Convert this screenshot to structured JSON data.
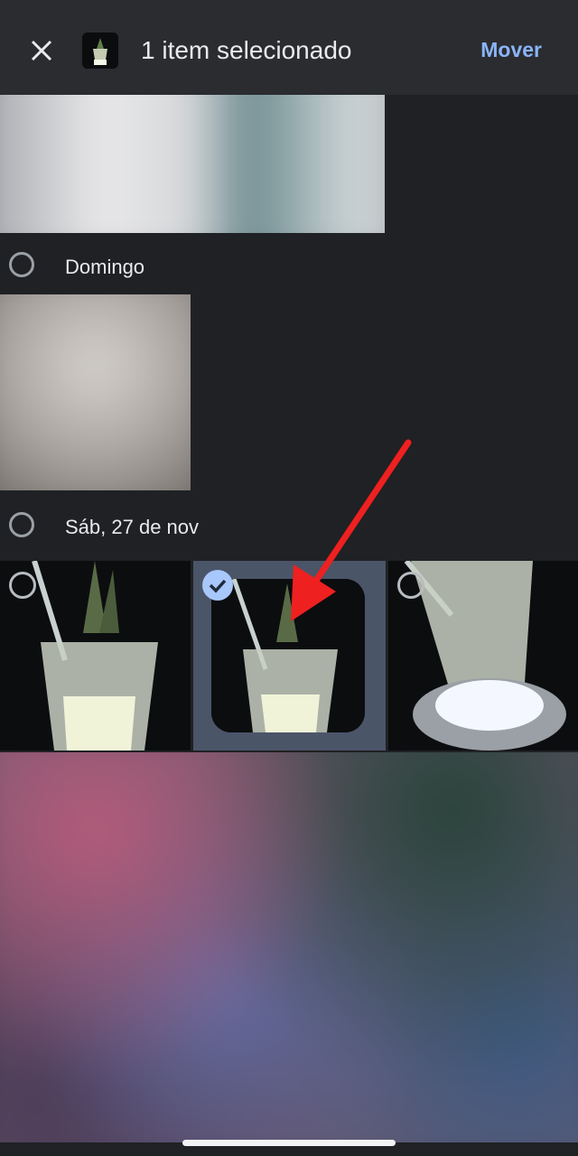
{
  "header": {
    "title": "1 item selecionado",
    "move_label": "Mover",
    "close_icon": "close-icon",
    "thumb_icon": "photo-thumbnail"
  },
  "days": [
    {
      "label": "Domingo"
    },
    {
      "label": "Sáb, 27 de nov"
    }
  ],
  "photos": [
    {
      "name": "drink-photo-left",
      "selected": false
    },
    {
      "name": "drink-photo-selected",
      "selected": true
    },
    {
      "name": "drink-photo-right",
      "selected": false
    }
  ],
  "colors": {
    "background": "#202124",
    "accent": "#8ab4f8",
    "selection_highlight": "#4b5568",
    "check_badge": "#a8c7fa",
    "annotation_arrow": "#ef2020"
  }
}
